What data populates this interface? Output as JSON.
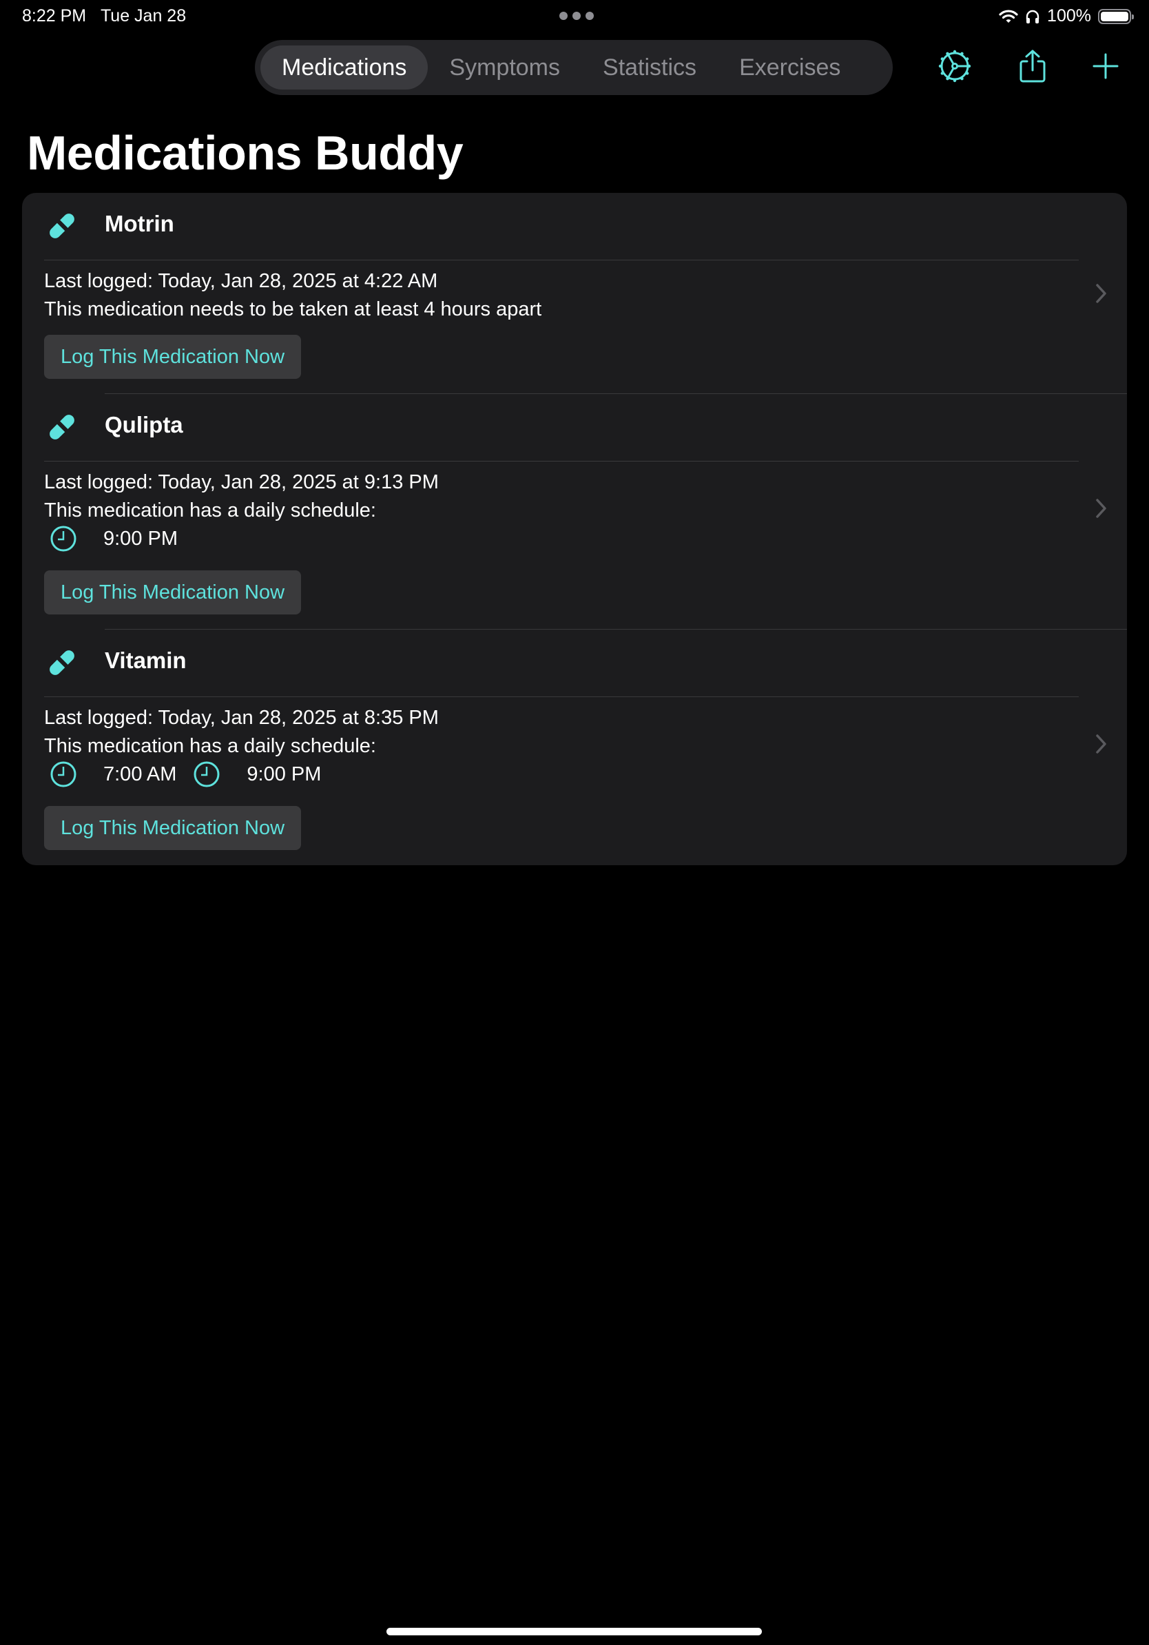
{
  "status_bar": {
    "time": "8:22 PM",
    "date": "Tue Jan 28",
    "battery_percent": "100%",
    "battery_level": 1.0,
    "icons": [
      "wifi-icon",
      "headphones-icon",
      "battery-icon"
    ]
  },
  "tabs": [
    {
      "label": "Medications",
      "active": true
    },
    {
      "label": "Symptoms",
      "active": false
    },
    {
      "label": "Statistics",
      "active": false
    },
    {
      "label": "Exercises",
      "active": false
    }
  ],
  "toolbar": {
    "icons": [
      "settings-gear-icon",
      "share-icon",
      "add-icon"
    ]
  },
  "page_title": "Medications Buddy",
  "colors": {
    "accent": "#5ee2dd",
    "background": "#000000",
    "card": "#1c1c1e",
    "button_bg": "#3a3a3c",
    "secondary_text": "#8e8e93"
  },
  "medications": [
    {
      "name": "Motrin",
      "last_logged": "Last logged: Today, Jan 28, 2025 at 4:22 AM",
      "note": "This medication needs to be taken at least 4 hours apart",
      "schedule_times": [],
      "button_label": "Log This Medication Now"
    },
    {
      "name": "Qulipta",
      "last_logged": "Last logged: Today, Jan 28, 2025 at 9:13 PM",
      "note": "This medication has a daily schedule:",
      "schedule_times": [
        "9:00 PM"
      ],
      "button_label": "Log This Medication Now"
    },
    {
      "name": "Vitamin",
      "last_logged": "Last logged: Today, Jan 28, 2025 at 8:35 PM",
      "note": "This medication has a daily schedule:",
      "schedule_times": [
        "7:00 AM",
        "9:00 PM"
      ],
      "button_label": "Log This Medication Now"
    }
  ]
}
